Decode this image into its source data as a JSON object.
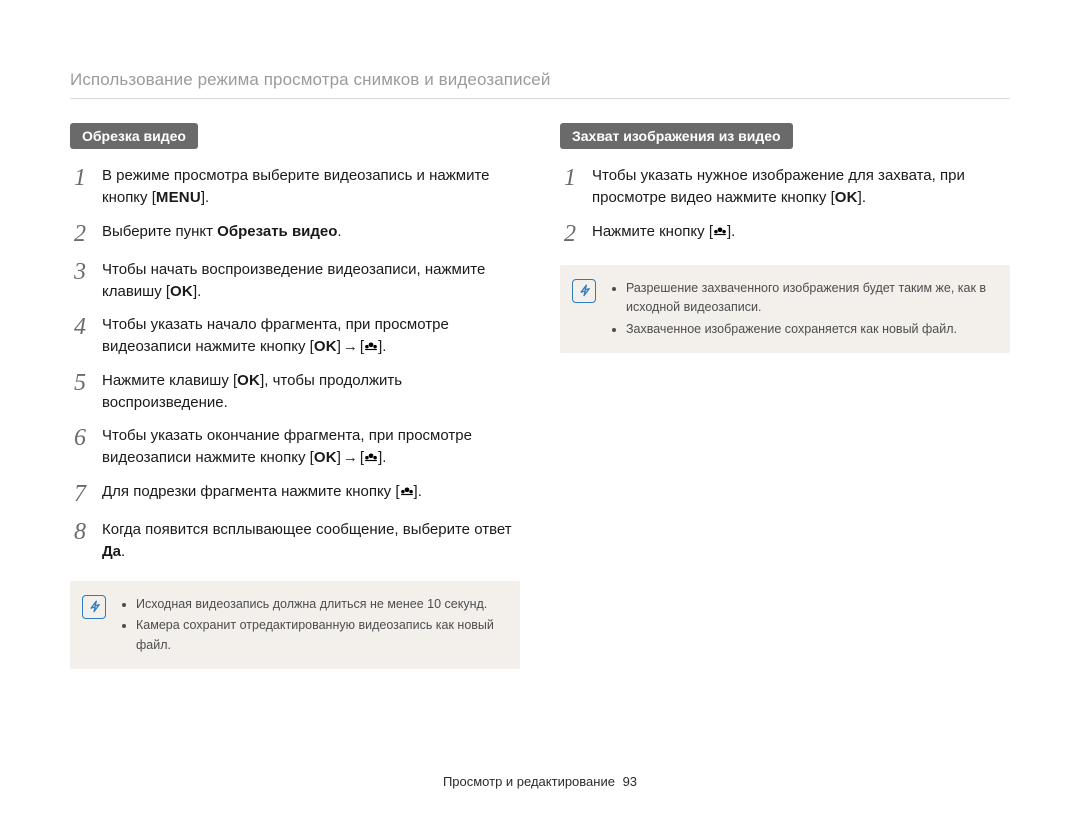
{
  "header": "Использование режима просмотра снимков и видеозаписей",
  "left": {
    "pill": "Обрезка видео",
    "steps": [
      {
        "pre": "В режиме просмотра выберите видеозапись и нажмите кнопку [",
        "btn": "MENU",
        "post": "]."
      },
      {
        "pre": "Выберите пункт ",
        "bold": "Обрезать видео",
        "post": "."
      },
      {
        "pre": "Чтобы начать воспроизведение видеозаписи, нажмите клавишу [",
        "btn": "OK",
        "post": "]."
      },
      {
        "pre": "Чтобы указать начало фрагмента, при просмотре видеозаписи нажмите кнопку [",
        "btn": "OK",
        "arrow": true,
        "post2": "]."
      },
      {
        "pre": "Нажмите клавишу [",
        "btn": "OK",
        "post": "], чтобы продолжить воспроизведение."
      },
      {
        "pre": "Чтобы указать окончание фрагмента, при просмотре видеозаписи нажмите кнопку [",
        "btn": "OK",
        "arrow": true,
        "post2": "]."
      },
      {
        "pre": "Для подрезки фрагмента нажмите кнопку [",
        "flower": true,
        "post": "]."
      },
      {
        "pre": "Когда появится всплывающее сообщение, выберите ответ ",
        "bold": "Да",
        "post": "."
      }
    ],
    "notes": [
      "Исходная видеозапись должна длиться не менее 10 секунд.",
      "Камера сохранит отредактированную видеозапись как новый файл."
    ]
  },
  "right": {
    "pill": "Захват изображения из видео",
    "steps": [
      {
        "pre": "Чтобы указать нужное изображение для захвата, при просмотре видео нажмите кнопку [",
        "btn": "OK",
        "post": "]."
      },
      {
        "pre": "Нажмите кнопку [",
        "flower": true,
        "post": "]."
      }
    ],
    "notes": [
      "Разрешение захваченного изображения будет таким же, как в исходной видеозаписи.",
      "Захваченное изображение сохраняется как новый файл."
    ]
  },
  "footer": {
    "section": "Просмотр и редактирование",
    "page": "93"
  }
}
